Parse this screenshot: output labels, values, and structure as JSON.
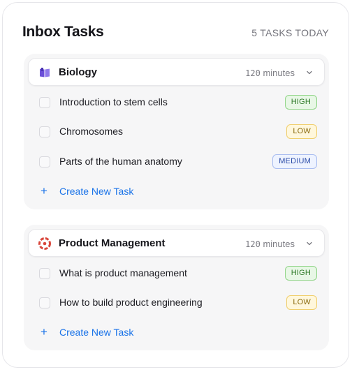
{
  "header": {
    "title": "Inbox Tasks",
    "count": "5 TASKS TODAY"
  },
  "groups": [
    {
      "name": "Biology",
      "icon": "book-icon",
      "duration_value": "120",
      "duration_unit": "minutes",
      "tasks": [
        {
          "label": "Introduction to stem cells",
          "priority": "HIGH"
        },
        {
          "label": "Chromosomes",
          "priority": "LOW"
        },
        {
          "label": "Parts of the human anatomy",
          "priority": "MEDIUM"
        }
      ],
      "create_label": "Create New Task"
    },
    {
      "name": "Product Management",
      "icon": "product-logo-icon",
      "duration_value": "120",
      "duration_unit": "minutes",
      "tasks": [
        {
          "label": "What is product management",
          "priority": "HIGH"
        },
        {
          "label": "How to build product engineering",
          "priority": "LOW"
        }
      ],
      "create_label": "Create New Task"
    }
  ],
  "colors": {
    "accent": "#1a73e8",
    "high": "#2f7a29",
    "low": "#8a6a0f",
    "medium": "#2d4da8",
    "book_icon": "#6b4fd8",
    "product_icon": "#d9463b"
  }
}
